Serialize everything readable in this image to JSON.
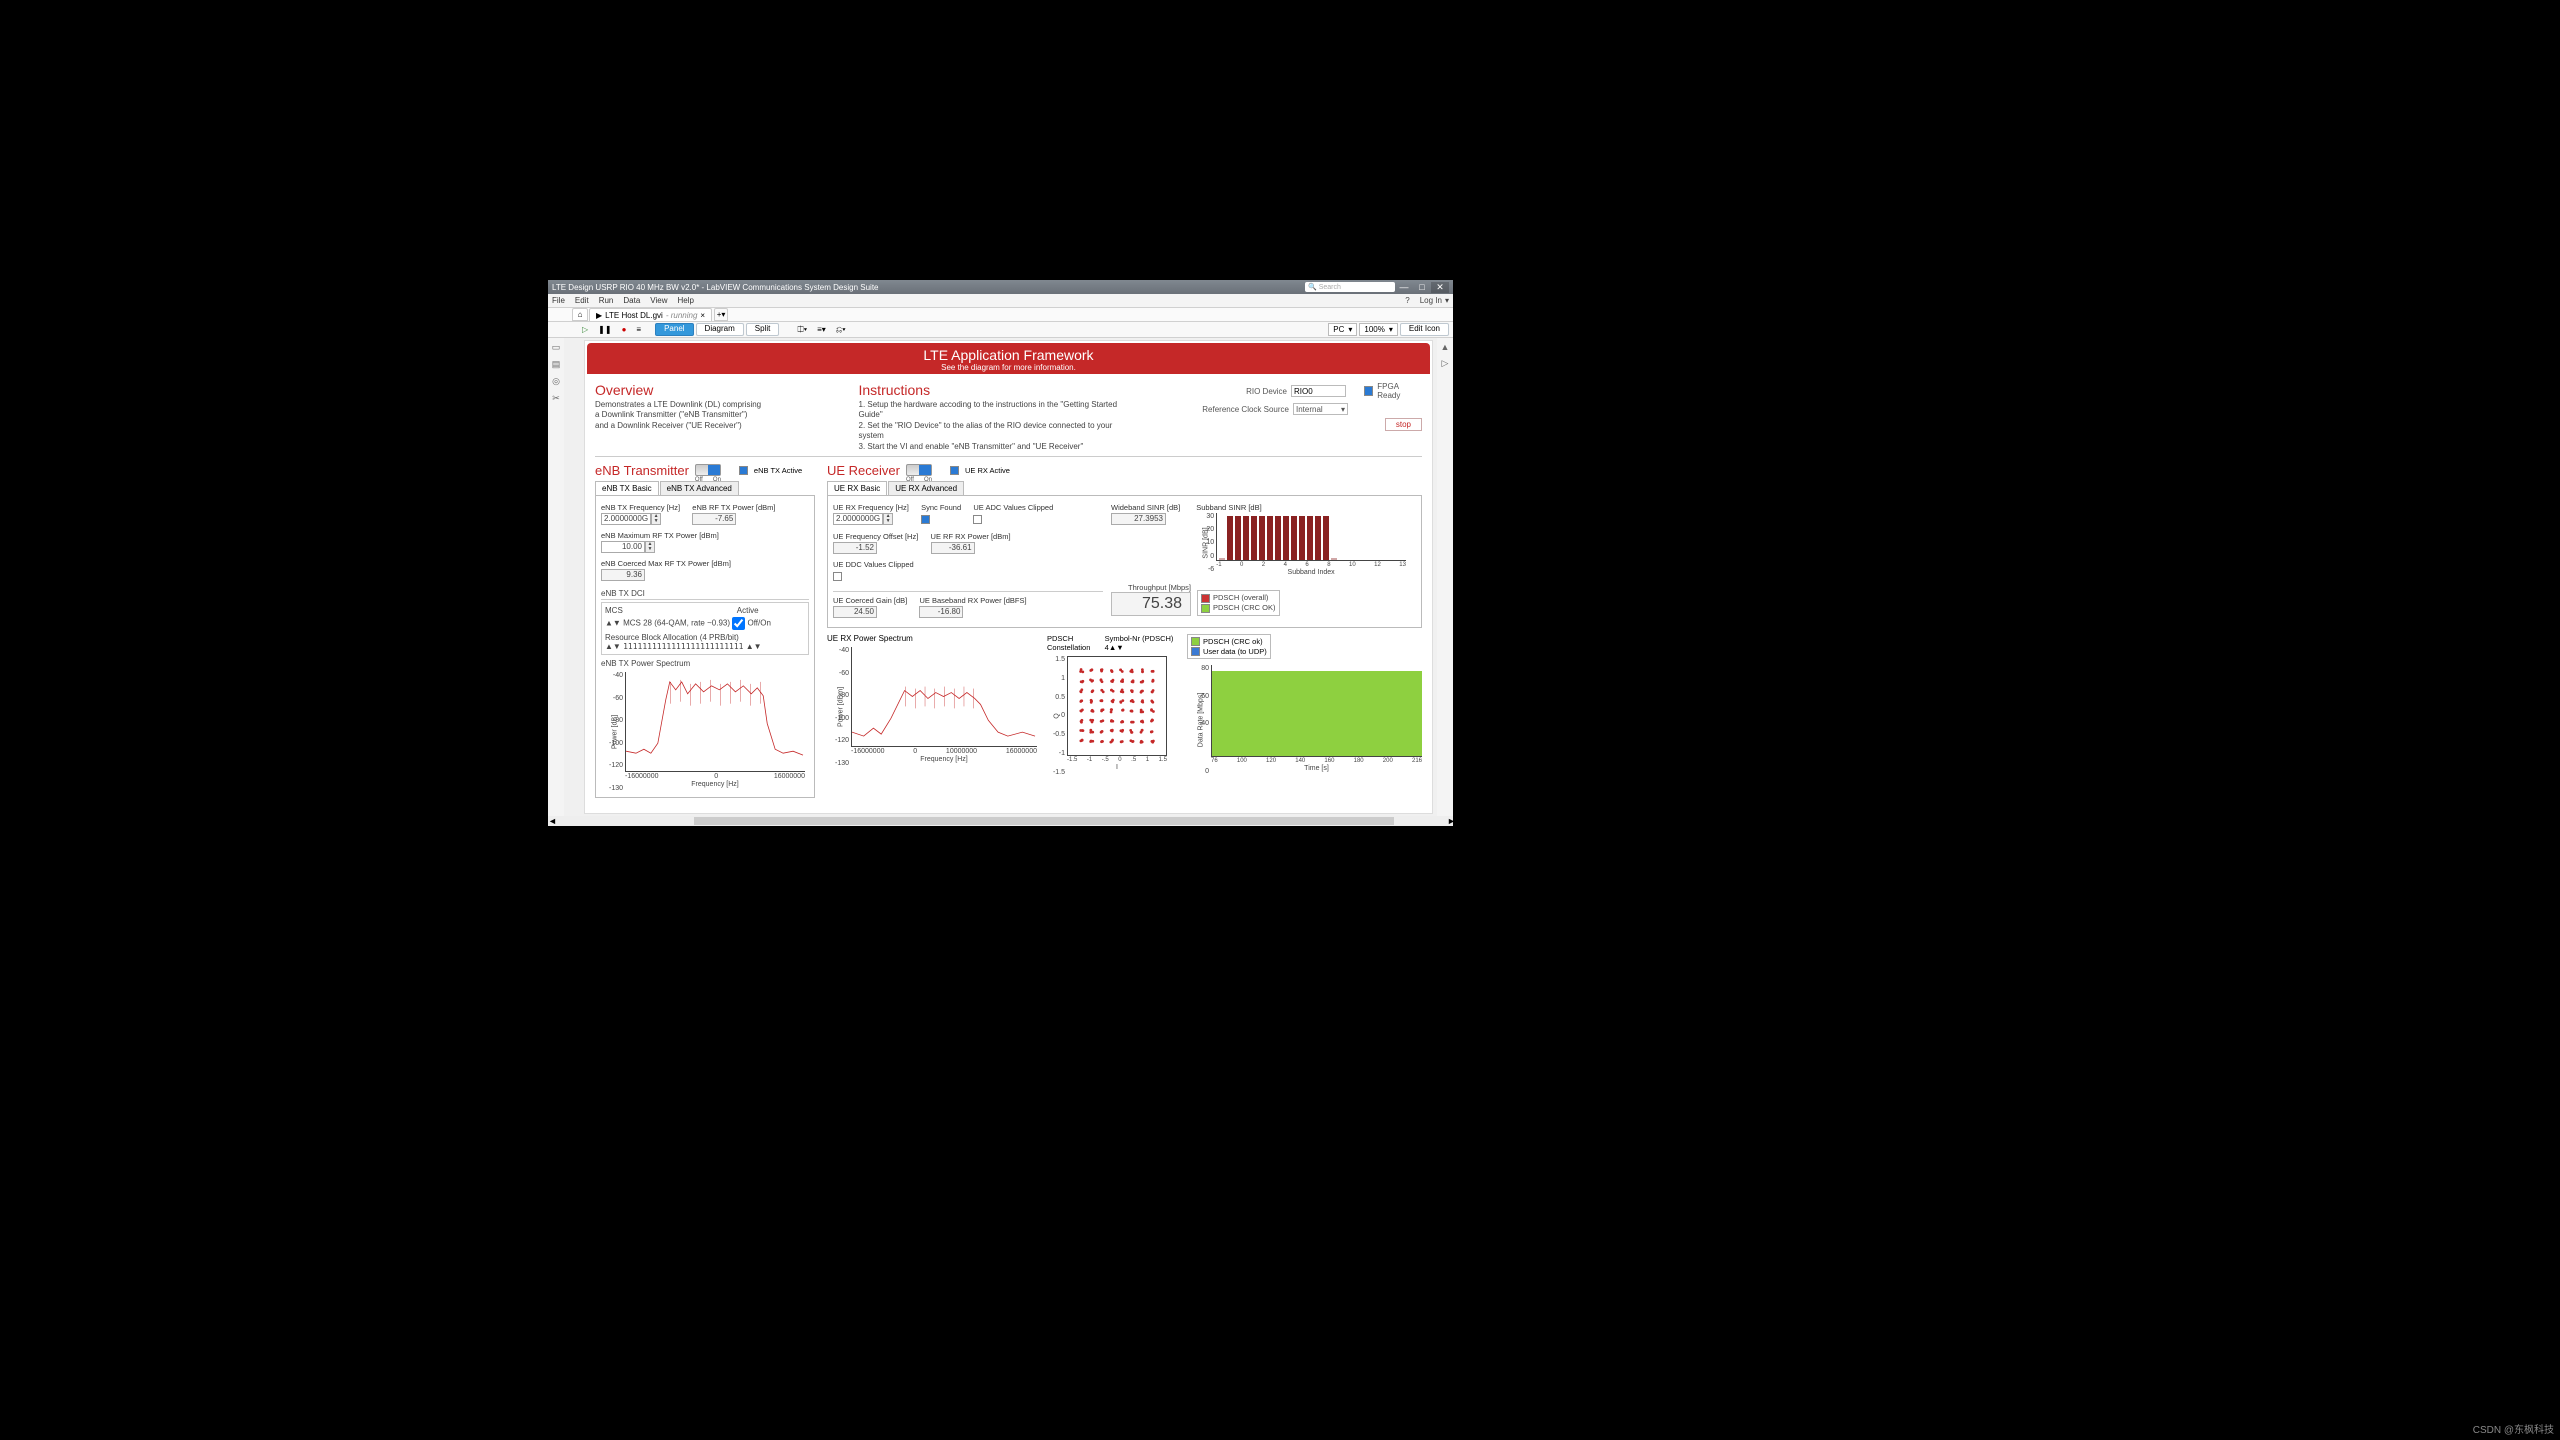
{
  "window": {
    "title": "LTE Design USRP RIO 40 MHz BW v2.0* - LabVIEW Communications System Design Suite",
    "search_placeholder": "Search",
    "min": "—",
    "max": "□",
    "close": "✕",
    "login": "Log In",
    "help": "?"
  },
  "menu": {
    "items": [
      "File",
      "Edit",
      "Run",
      "Data",
      "View",
      "Help"
    ]
  },
  "filetab": {
    "name": "LTE Host DL.gvi",
    "state": "running",
    "play": "▶",
    "home": "⌂",
    "plus": "+",
    "close_x": "×"
  },
  "toolbar": {
    "run": "▷",
    "pause": "❚❚",
    "rec": "●",
    "menu": "≡",
    "views": {
      "panel": "Panel",
      "diagram": "Diagram",
      "split": "Split"
    },
    "target": "PC",
    "zoom": "100%",
    "edit_icon": "Edit Icon"
  },
  "banner": {
    "title": "LTE Application Framework",
    "sub": "See the diagram for more information."
  },
  "overview": {
    "title": "Overview",
    "l1": "Demonstrates a LTE Downlink (DL) comprising",
    "l2": "a Downlink Transmitter (\"eNB Transmitter\")",
    "l3": "and a Downlink Receiver (\"UE Receiver\")"
  },
  "instructions": {
    "title": "Instructions",
    "l1": "1. Setup the hardware accoding to the instructions in the \"Getting Started Guide\"",
    "l2": "2. Set the \"RIO Device\" to the alias of the RIO device connected to your system",
    "l3": "3. Start the VI and enable \"eNB Transmitter\" and \"UE Receiver\""
  },
  "device": {
    "rio_label": "RIO Device",
    "rio_value": "RIO0",
    "clk_label": "Reference Clock Source",
    "clk_value": "Internal",
    "fpga_label": "FPGA Ready",
    "stop": "stop"
  },
  "enb": {
    "title": "eNB Transmitter",
    "active_label": "eNB TX Active",
    "off": "Off",
    "on": "On",
    "tabs": {
      "basic": "eNB TX Basic",
      "adv": "eNB TX Advanced"
    },
    "freq_label": "eNB TX Frequency [Hz]",
    "freq_value": "2.0000000G",
    "rfpow_label": "eNB RF TX Power [dBm]",
    "rfpow_value": "-7.65",
    "maxrf_label": "eNB Maximum RF TX Power [dBm]",
    "maxrf_value": "10.00",
    "coerced_label": "eNB Coerced Max RF TX Power [dBm]",
    "coerced_value": "9.36",
    "dci_label": "eNB TX DCI",
    "mcs_label": "MCS",
    "active_lbl": "Active",
    "mcs_value": "MCS 28 (64-QAM, rate ~0.93)",
    "offon": "Off/On",
    "rb_label": "Resource Block Allocation (4 PRB/bit)",
    "rb_value": "1111111111111111111111111",
    "spectrum_title": "eNB TX Power Spectrum"
  },
  "ue": {
    "title": "UE Receiver",
    "active_label": "UE RX Active",
    "off": "Off",
    "on": "On",
    "tabs": {
      "basic": "UE RX Basic",
      "adv": "UE RX Advanced"
    },
    "freq_label": "UE RX Frequency [Hz]",
    "freq_value": "2.0000000G",
    "sync_label": "Sync Found",
    "adc_label": "UE ADC Values Clipped",
    "offset_label": "UE Frequency Offset [Hz]",
    "offset_value": "-1.52",
    "rfpow_label": "UE RF RX Power [dBm]",
    "rfpow_value": "-36.61",
    "ddc_label": "UE DDC Values Clipped",
    "gain_label": "UE Coerced Gain [dB]",
    "gain_value": "24.50",
    "bb_label": "UE Baseband RX Power [dBFS]",
    "bb_value": "-16.80",
    "spectrum_title": "UE RX Power Spectrum",
    "constellation_title": "PDSCH Constellation",
    "symnr_label": "Symbol-Nr (PDSCH)",
    "symnr_value": "4"
  },
  "sinr": {
    "wide_label": "Wideband SINR [dB]",
    "wide_value": "27.3953",
    "sub_label": "Subband SINR [dB]"
  },
  "throughput": {
    "label": "Throughput [Mbps]",
    "value": "75.38"
  },
  "legend": {
    "l1": "PDSCH (overall)",
    "l2": "PDSCH (CRC OK)",
    "l3": "PDSCH (CRC ok)",
    "l4": "User data (to UDP)"
  },
  "chart_data": [
    {
      "type": "line",
      "name": "eNB TX Power Spectrum",
      "xlabel": "Frequency [Hz]",
      "ylabel": "Power [dB]",
      "xlim": [
        -16000000,
        16000000
      ],
      "ylim": [
        -130,
        -40
      ],
      "yticks": [
        -40,
        -60,
        -80,
        -100,
        -120,
        -130
      ],
      "note": "noisy spectrum ~-50 dB in-band (≈±9 MHz), ~-110/-115 dB out-of-band"
    },
    {
      "type": "line",
      "name": "UE RX Power Spectrum",
      "xlabel": "Frequency [Hz]",
      "ylabel": "Power [dBm]",
      "xlim": [
        -16000000,
        16000000
      ],
      "ylim": [
        -130,
        -40
      ],
      "yticks": [
        -40,
        -60,
        -80,
        -100,
        -120,
        -130
      ],
      "note": "noisy spectrum ~-80 dB in-band, ~-100/-120 dB out-of-band"
    },
    {
      "type": "scatter",
      "name": "PDSCH Constellation",
      "xlabel": "I",
      "ylabel": "Q",
      "xlim": [
        -1.5,
        1.5
      ],
      "ylim": [
        -1.5,
        1.5
      ],
      "ticks": [
        -1.5,
        -1,
        -0.5,
        0,
        0.5,
        1,
        1.5
      ],
      "note": "64-QAM grid 8x8 centered, points ≈ ±{0.15,0.46,0.77,1.08}"
    },
    {
      "type": "bar",
      "name": "Subband SINR",
      "xlabel": "Subband Index",
      "ylabel": "SINR [dB]",
      "categories": [
        -1,
        0,
        1,
        2,
        3,
        4,
        5,
        6,
        7,
        8,
        9,
        10,
        11,
        12,
        13
      ],
      "values": [
        -5,
        27,
        27,
        27,
        27,
        27,
        27,
        27,
        27,
        27,
        27,
        27,
        27,
        27,
        -5
      ],
      "ylim": [
        -6,
        30
      ],
      "yticks": [
        30,
        20,
        10,
        0,
        -6
      ]
    },
    {
      "type": "area",
      "name": "Throughput",
      "xlabel": "Time [s]",
      "ylabel": "Data Rate [Mbps]",
      "xlim": [
        76,
        216
      ],
      "ylim": [
        0,
        80
      ],
      "xticks": [
        76,
        100,
        120,
        140,
        160,
        180,
        200,
        216
      ],
      "yticks": [
        80,
        60,
        40,
        0
      ],
      "series": [
        {
          "name": "PDSCH",
          "note": "flat ≈75 Mbps across window"
        }
      ]
    }
  ],
  "watermark": "CSDN @东枫科技"
}
